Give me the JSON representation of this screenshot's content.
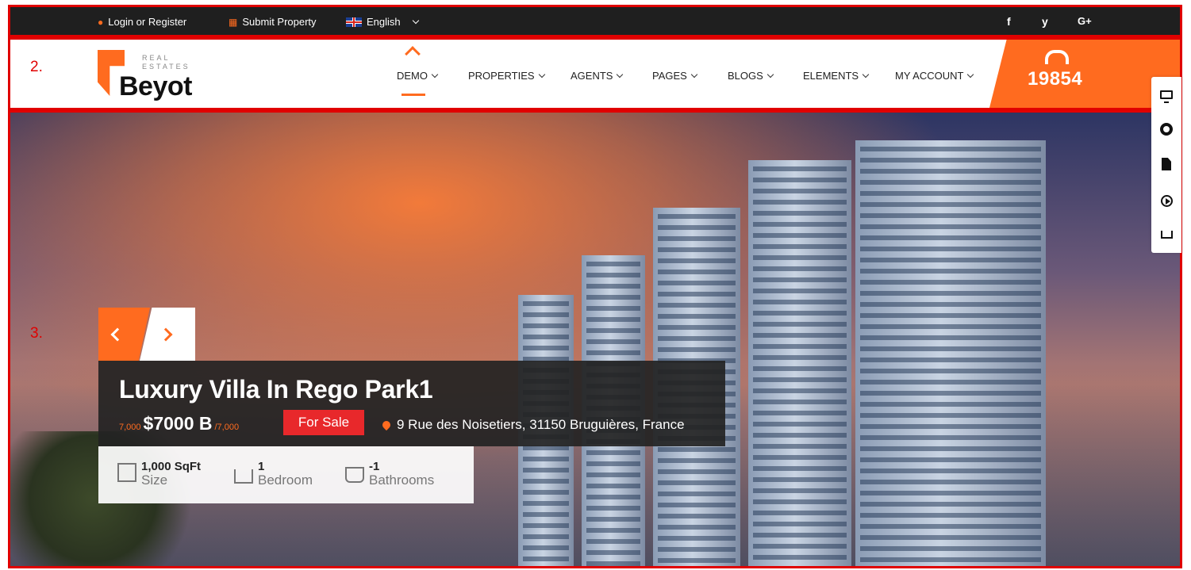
{
  "topbar": {
    "login_label": "Login or Register",
    "submit_label": "Submit Property",
    "language": "English",
    "social": [
      "f",
      "y",
      "G+"
    ]
  },
  "annotations": {
    "header": "2.",
    "hero": "3."
  },
  "logo": {
    "tagline": "REAL ESTATES",
    "name": "Beyot"
  },
  "nav": {
    "items": [
      "DEMO",
      "PROPERTIES",
      "AGENTS",
      "PAGES",
      "BLOGS",
      "ELEMENTS",
      "MY ACCOUNT"
    ],
    "active": "DEMO"
  },
  "phone": {
    "number": "19854"
  },
  "listing": {
    "title": "Luxury Villa In Rego Park1",
    "price_prefix": "7,000",
    "price": "$7000 B",
    "price_suffix": "/7,000",
    "status": "For Sale",
    "address": "9 Rue des Noisetiers, 31150 Bruguières, France",
    "specs": [
      {
        "value": "1,000 SqFt",
        "label": "Size"
      },
      {
        "value": "1",
        "label": "Bedroom"
      },
      {
        "value": "-1",
        "label": "Bathrooms"
      }
    ]
  },
  "side_tools": [
    "monitor-icon",
    "lifering-icon",
    "document-icon",
    "play-icon",
    "cart-icon"
  ],
  "colors": {
    "accent": "#ff6b1f",
    "topbar": "#1f1f1f",
    "sale": "#e8282b",
    "annotation": "#e00000"
  }
}
